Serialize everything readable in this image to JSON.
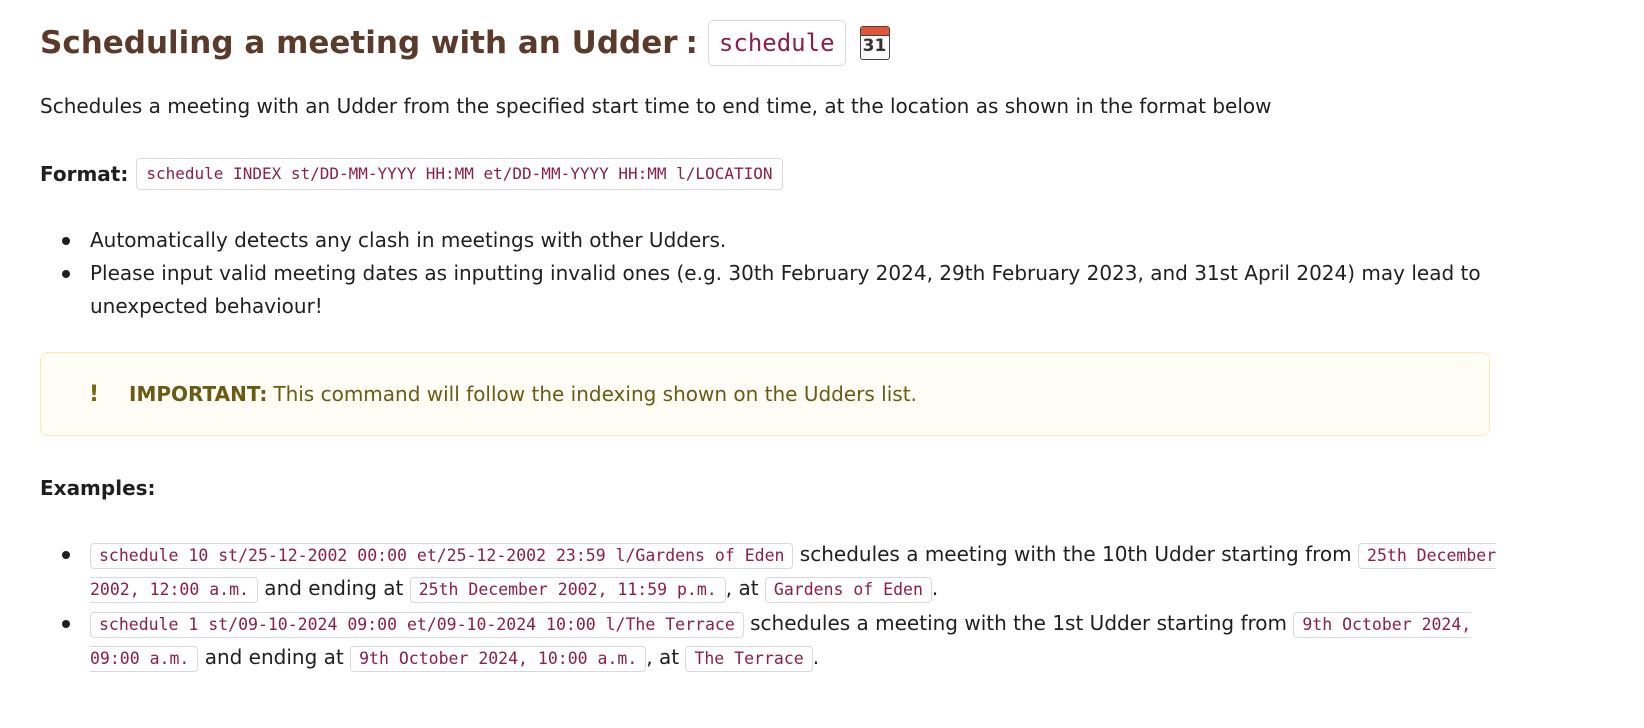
{
  "heading": {
    "title": "Scheduling a meeting with an Udder",
    "colon": ":",
    "command": "schedule",
    "icon": "calendar-icon",
    "icon_number": "31"
  },
  "intro": "Schedules a meeting with an Udder from the specified start time to end time, at the location as shown in the format below",
  "format": {
    "label": "Format:",
    "syntax": "schedule INDEX st/DD-MM-YYYY HH:MM et/DD-MM-YYYY HH:MM l/LOCATION"
  },
  "notes": [
    "Automatically detects any clash in meetings with other Udders.",
    "Please input valid meeting dates as inputting invalid ones (e.g. 30th February 2024, 29th February 2023, and 31st April 2024) may lead to unexpected behaviour!"
  ],
  "important": {
    "icon": "!",
    "label": "IMPORTANT:",
    "text": "This command will follow the indexing shown on the Udders list."
  },
  "examples_title": "Examples:",
  "examples": [
    {
      "command": "schedule 10 st/25-12-2002 00:00 et/25-12-2002 23:59 l/Gardens of Eden",
      "text1": " schedules a meeting with the 10th Udder starting from ",
      "start": "25th December 2002, 12:00 a.m.",
      "text2": " and ending at ",
      "end": "25th December 2002, 11:59 p.m.",
      "text3": ", at ",
      "location": "Gardens of Eden",
      "text4": "."
    },
    {
      "command": "schedule 1 st/09-10-2024 09:00 et/09-10-2024 10:00 l/The Terrace",
      "text1": " schedules a meeting with the 1st Udder starting from ",
      "start": "9th October 2024, 09:00 a.m.",
      "text2": " and ending at ",
      "end": "9th October 2024, 10:00 a.m.",
      "text3": ", at ",
      "location": "The Terrace",
      "text4": "."
    }
  ],
  "colors": {
    "heading": "#5a3b2b",
    "code_text": "#8b1e4f",
    "callout_border": "#fbeab4",
    "callout_text": "#6b5a12"
  }
}
